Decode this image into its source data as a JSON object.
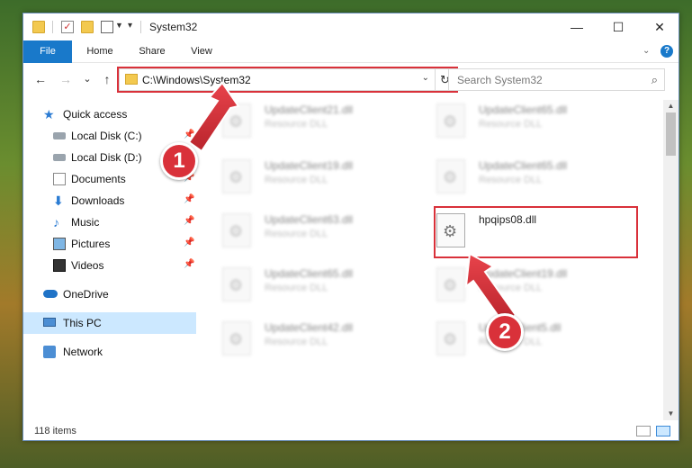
{
  "window": {
    "title": "System32"
  },
  "ribbon": {
    "tabs": [
      "File",
      "Home",
      "Share",
      "View"
    ],
    "help": "?"
  },
  "nav": {
    "back": "←",
    "forward": "→",
    "recent": "⌄",
    "up": "↑",
    "address": "C:\\Windows\\System32",
    "refresh": "↻",
    "search_placeholder": "Search System32"
  },
  "sidebar": {
    "items": [
      {
        "label": "Quick access",
        "icon": "star-icon"
      },
      {
        "label": "Local Disk (C:)",
        "icon": "drive-icon"
      },
      {
        "label": "Local Disk (D:)",
        "icon": "drive-icon"
      },
      {
        "label": "Documents",
        "icon": "documents-icon"
      },
      {
        "label": "Downloads",
        "icon": "download-icon"
      },
      {
        "label": "Music",
        "icon": "music-icon"
      },
      {
        "label": "Pictures",
        "icon": "pictures-icon"
      },
      {
        "label": "Videos",
        "icon": "videos-icon"
      },
      {
        "label": "OneDrive",
        "icon": "cloud-icon"
      },
      {
        "label": "This PC",
        "icon": "computer-icon",
        "selected": true
      },
      {
        "label": "Network",
        "icon": "network-icon"
      }
    ]
  },
  "files": [
    {
      "name": "UpdateClient21.dll",
      "type": "Resource DLL"
    },
    {
      "name": "UpdateClient65.dll",
      "type": "Resource DLL"
    },
    {
      "name": "UpdateClient19.dll",
      "type": "Resource DLL"
    },
    {
      "name": "UpdateClient65.dll",
      "type": "Resource DLL"
    },
    {
      "name": "UpdateClient63.dll",
      "type": "Resource DLL"
    },
    {
      "name": "hpqips08.dll",
      "type": ""
    },
    {
      "name": "UpdateClient65.dll",
      "type": "Resource DLL"
    },
    {
      "name": "UpdateClient19.dll",
      "type": "Resource DLL"
    },
    {
      "name": "UpdateClient42.dll",
      "type": "Resource DLL"
    },
    {
      "name": "UpdateClient5.dll",
      "type": "Resource DLL"
    }
  ],
  "status": {
    "items_count": "118 items"
  },
  "callouts": [
    "1",
    "2"
  ],
  "colors": {
    "accent": "#1979ca",
    "highlight": "#d9313a",
    "selected": "#cce8ff"
  }
}
